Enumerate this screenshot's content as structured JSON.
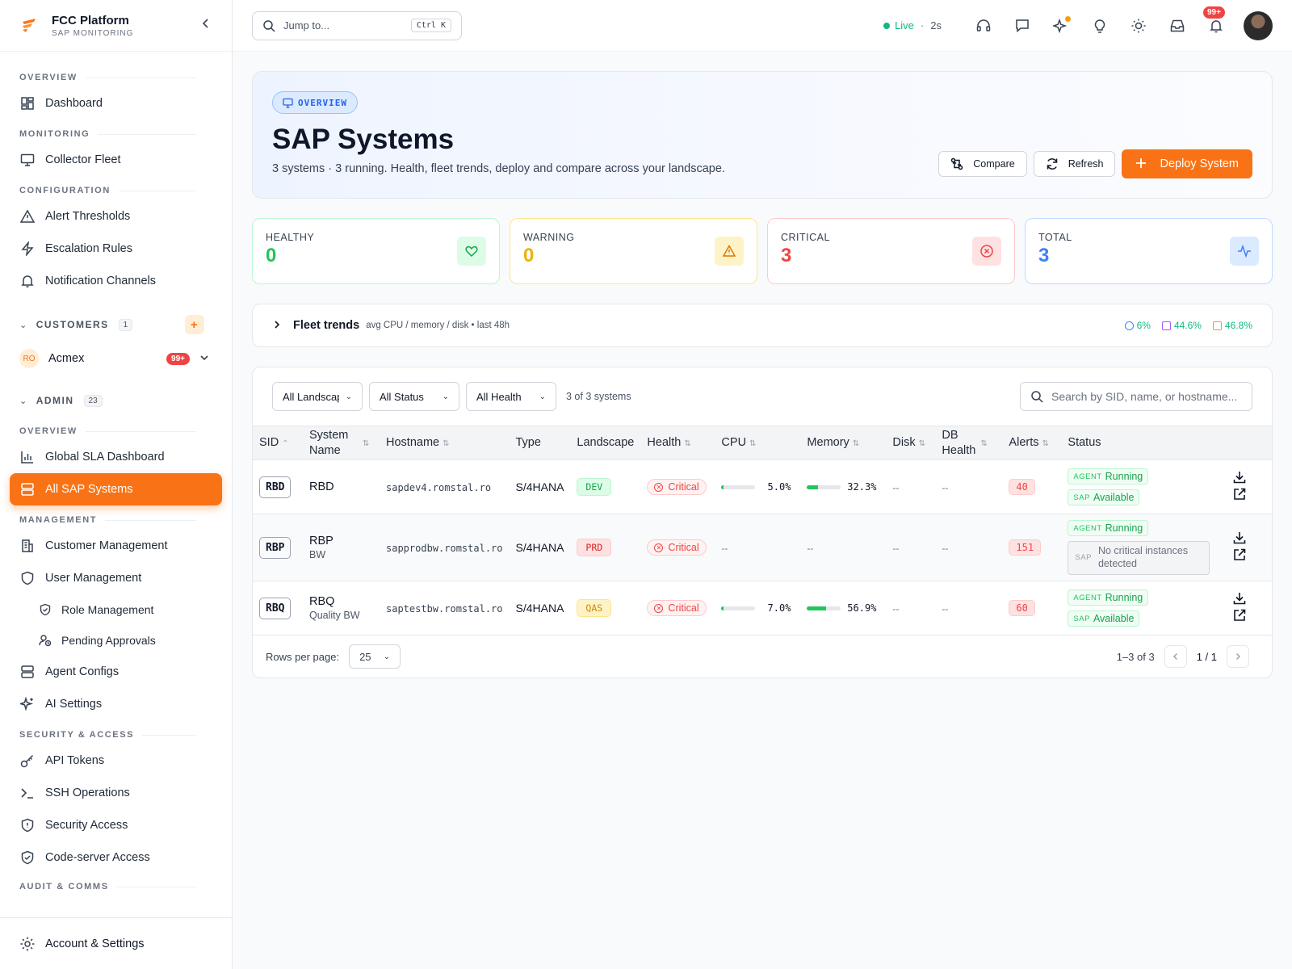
{
  "brand": {
    "title": "FCC Platform",
    "subtitle": "SAP MONITORING"
  },
  "sidebar": {
    "overview_label": "OVERVIEW",
    "dashboard": "Dashboard",
    "monitoring_label": "MONITORING",
    "collector_fleet": "Collector Fleet",
    "configuration_label": "CONFIGURATION",
    "alert_thresholds": "Alert Thresholds",
    "escalation_rules": "Escalation Rules",
    "notification_channels": "Notification Channels",
    "customers_label": "CUSTOMERS",
    "customers_count": "1",
    "customer": {
      "initials": "RO",
      "name": "Acmex",
      "badge": "99+"
    },
    "admin_label": "ADMIN",
    "admin_count": "23",
    "admin_overview_label": "OVERVIEW",
    "global_sla": "Global SLA Dashboard",
    "all_sap": "All SAP Systems",
    "management_label": "MANAGEMENT",
    "customer_mgmt": "Customer Management",
    "user_mgmt": "User Management",
    "role_mgmt": "Role Management",
    "pending": "Pending Approvals",
    "agent_configs": "Agent Configs",
    "ai_settings": "AI Settings",
    "security_label": "SECURITY & ACCESS",
    "api_tokens": "API Tokens",
    "ssh_ops": "SSH Operations",
    "security_access": "Security Access",
    "code_server": "Code-server Access",
    "audit_label": "AUDIT & COMMS",
    "account": "Account & Settings"
  },
  "topbar": {
    "jump_placeholder": "Jump to...",
    "shortcut": "Ctrl K",
    "live": "Live",
    "sep": "·",
    "interval": "2s",
    "notif_badge": "99+"
  },
  "hero": {
    "pill": "OVERVIEW",
    "title": "SAP Systems",
    "subtitle": "3 systems · 3 running. Health, fleet trends, deploy and compare across your landscape.",
    "compare": "Compare",
    "refresh": "Refresh",
    "deploy": "Deploy System"
  },
  "stats": [
    {
      "label": "HEALTHY",
      "value": "0"
    },
    {
      "label": "WARNING",
      "value": "0"
    },
    {
      "label": "CRITICAL",
      "value": "3"
    },
    {
      "label": "TOTAL",
      "value": "3"
    }
  ],
  "trends": {
    "title": "Fleet trends",
    "subtitle": "avg CPU / memory / disk • last 48h",
    "cpu": "6%",
    "memory": "44.6%",
    "disk": "46.8%",
    "colors": {
      "cpu": "#3b82f6",
      "memory": "#a855f7",
      "disk": "#f59e0b",
      "text": "#10b981"
    }
  },
  "filters": {
    "landscape": "All Landscapes",
    "status": "All Status",
    "health": "All Health",
    "count": "3 of 3 systems",
    "search_placeholder": "Search by SID, name, or hostname..."
  },
  "table": {
    "headers": {
      "sid": "SID",
      "system_name": "System Name",
      "hostname": "Hostname",
      "type": "Type",
      "landscape": "Landscape",
      "health": "Health",
      "cpu": "CPU",
      "memory": "Memory",
      "disk": "Disk",
      "db_health": "DB Health",
      "alerts": "Alerts",
      "status": "Status"
    },
    "rows": [
      {
        "sid": "RBD",
        "name": "RBD",
        "sub": "",
        "host": "sapdev4.romstal.ro",
        "type": "S/4HANA",
        "landscape": "DEV",
        "health": "Critical",
        "cpu": "5.0%",
        "cpu_frac": 0.05,
        "memory": "32.3%",
        "mem_frac": 0.323,
        "disk": "--",
        "db": "--",
        "alerts": "40",
        "agent_tag": "AGENT",
        "agent": "Running",
        "sap_tag": "SAP",
        "sap": "Available"
      },
      {
        "sid": "RBP",
        "name": "RBP",
        "sub": "BW",
        "host": "sapprodbw.romstal.ro",
        "type": "S/4HANA",
        "landscape": "PRD",
        "health": "Critical",
        "cpu": "--",
        "memory": "--",
        "disk": "--",
        "db": "--",
        "alerts": "151",
        "agent_tag": "AGENT",
        "agent": "Running",
        "sap_tag": "SAP",
        "sap": "No critical instances detected"
      },
      {
        "sid": "RBQ",
        "name": "RBQ",
        "sub": "Quality BW",
        "host": "saptestbw.romstal.ro",
        "type": "S/4HANA",
        "landscape": "QAS",
        "health": "Critical",
        "cpu": "7.0%",
        "cpu_frac": 0.07,
        "memory": "56.9%",
        "mem_frac": 0.569,
        "disk": "--",
        "db": "--",
        "alerts": "60",
        "agent_tag": "AGENT",
        "agent": "Running",
        "sap_tag": "SAP",
        "sap": "Available"
      }
    ]
  },
  "footer": {
    "rows_per_page_label": "Rows per page:",
    "rows_per_page": "25",
    "range": "1–3 of 3",
    "page": "1 / 1"
  }
}
